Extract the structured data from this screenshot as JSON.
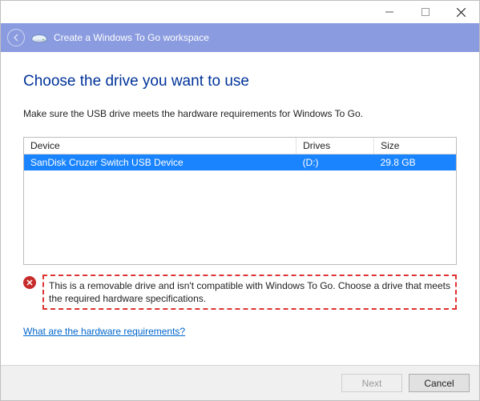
{
  "titlebar": {
    "minimize": "minimize",
    "maximize": "maximize",
    "close": "close"
  },
  "header": {
    "title": "Create a Windows To Go workspace"
  },
  "main": {
    "heading": "Choose the drive you want to use",
    "instruction": "Make sure the USB drive meets the hardware requirements for Windows To Go.",
    "columns": {
      "device": "Device",
      "drives": "Drives",
      "size": "Size"
    },
    "rows": [
      {
        "device": "SanDisk Cruzer Switch USB Device",
        "drives": "(D:)",
        "size": "29.8 GB"
      }
    ],
    "error": "This is a removable drive and isn't compatible with Windows To Go. Choose a drive that meets the required hardware specifications.",
    "link": "What are the hardware requirements?"
  },
  "footer": {
    "next": "Next",
    "cancel": "Cancel"
  }
}
